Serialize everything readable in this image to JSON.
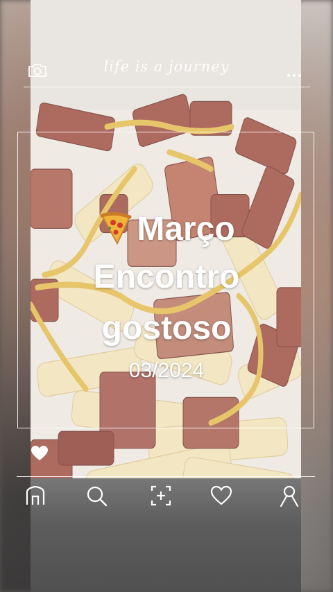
{
  "header": {
    "brand": "life is a journey",
    "camera_icon": "camera-icon",
    "menu_icon": "more-dots-icon"
  },
  "post": {
    "line1_emoji": "pizza-icon",
    "line1": "Março",
    "line2": "Encontro",
    "line3": "gostoso",
    "date": "03/2024"
  },
  "actions": {
    "like_icon": "heart-filled-icon"
  },
  "bottom_nav": {
    "items": [
      {
        "icon": "home-icon"
      },
      {
        "icon": "search-icon"
      },
      {
        "icon": "add-post-icon"
      },
      {
        "icon": "heart-outline-icon"
      },
      {
        "icon": "profile-icon"
      }
    ]
  },
  "colors": {
    "text": "#ffffff",
    "sauce": "#e2b94a",
    "bacon": "#9b4a3c",
    "fries": "#f1e1b6"
  }
}
